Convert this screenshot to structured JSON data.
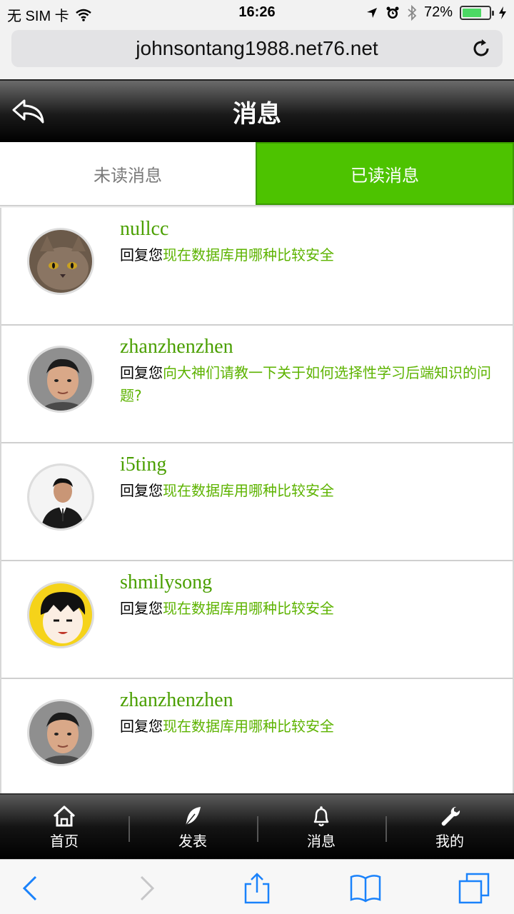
{
  "status_bar": {
    "carrier": "无 SIM 卡",
    "time": "16:26",
    "battery_percent": "72%",
    "battery_level": 0.72
  },
  "url_bar": {
    "url": "johnsontang1988.net76.net"
  },
  "header": {
    "title": "消息"
  },
  "tabs": [
    {
      "label": "未读消息",
      "active": false
    },
    {
      "label": "已读消息",
      "active": true
    }
  ],
  "messages": [
    {
      "username": "nullcc",
      "prefix": "回复您",
      "topic": "现在数据库用哪种比较安全"
    },
    {
      "username": "zhanzhenzhen",
      "prefix": "回复您",
      "topic": "向大神们请教一下关于如何选择性学习后端知识的问题?"
    },
    {
      "username": "i5ting",
      "prefix": "回复您",
      "topic": "现在数据库用哪种比较安全"
    },
    {
      "username": "shmilysong",
      "prefix": "回复您",
      "topic": "现在数据库用哪种比较安全"
    },
    {
      "username": "zhanzhenzhen",
      "prefix": "回复您",
      "topic": "现在数据库用哪种比较安全"
    }
  ],
  "bottom_nav": [
    {
      "label": "首页",
      "icon": "home-icon"
    },
    {
      "label": "发表",
      "icon": "feather-icon"
    },
    {
      "label": "消息",
      "icon": "bell-icon"
    },
    {
      "label": "我的",
      "icon": "wrench-icon"
    }
  ],
  "colors": {
    "accent_green": "#4dc300",
    "username_green": "#4a9f00",
    "topic_green": "#5db300",
    "ios_blue": "#1a82fb"
  }
}
